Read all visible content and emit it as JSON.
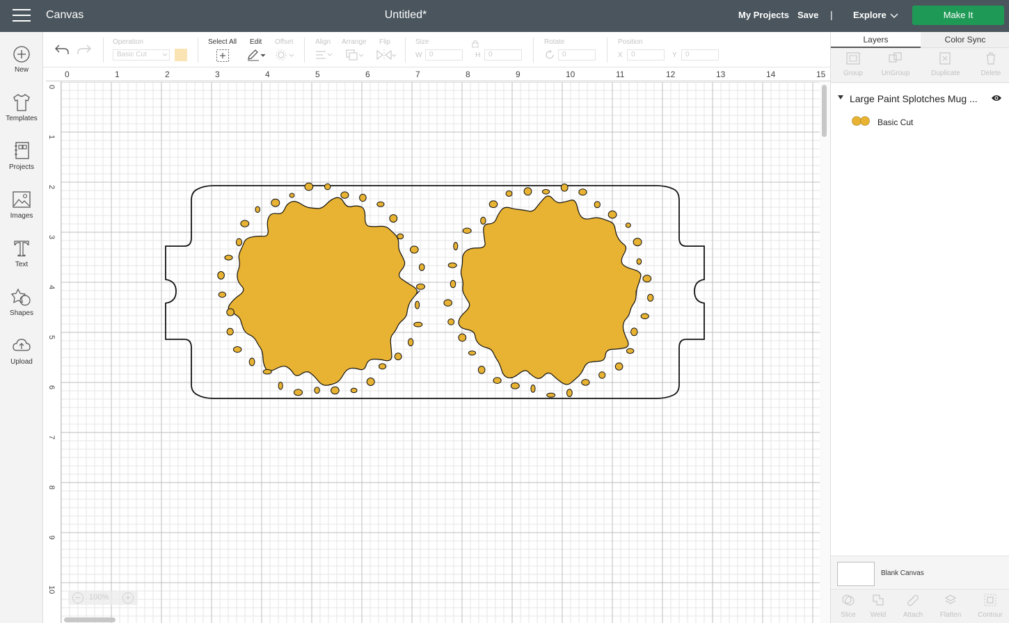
{
  "topbar": {
    "app_title": "Canvas",
    "doc_title": "Untitled*",
    "my_projects": "My Projects",
    "save": "Save",
    "divider": "|",
    "explore": "Explore",
    "make_it": "Make It"
  },
  "sidebar": {
    "items": [
      {
        "label": "New",
        "icon": "plus-circle-icon"
      },
      {
        "label": "Templates",
        "icon": "tshirt-icon"
      },
      {
        "label": "Projects",
        "icon": "projects-icon"
      },
      {
        "label": "Images",
        "icon": "image-icon"
      },
      {
        "label": "Text",
        "icon": "text-icon"
      },
      {
        "label": "Shapes",
        "icon": "shapes-icon"
      },
      {
        "label": "Upload",
        "icon": "upload-icon"
      }
    ]
  },
  "toolbar": {
    "operation_label": "Operation",
    "operation_value": "Basic Cut",
    "operation_color": "#fbe4b4",
    "select_all": "Select All",
    "edit": "Edit",
    "offset": "Offset",
    "align": "Align",
    "arrange": "Arrange",
    "flip": "Flip",
    "size": "Size",
    "size_w_label": "W",
    "size_w": "0",
    "size_h_label": "H",
    "size_h": "0",
    "rotate": "Rotate",
    "rotate_value": "0",
    "position": "Position",
    "pos_x_label": "X",
    "pos_x": "0",
    "pos_y_label": "Y",
    "pos_y": "0"
  },
  "rpanel": {
    "tabs": [
      "Layers",
      "Color Sync"
    ],
    "actions": [
      "Group",
      "UnGroup",
      "Duplicate",
      "Delete"
    ],
    "group_name": "Large Paint Splotches Mug ...",
    "layer_name": "Basic Cut",
    "layer_color": "#e8b333",
    "blank_canvas": "Blank Canvas",
    "bottom_actions": [
      "Slice",
      "Weld",
      "Attach",
      "Flatten",
      "Contour"
    ]
  },
  "canvas": {
    "ruler_top": [
      "0",
      "1",
      "2",
      "3",
      "4",
      "5",
      "6",
      "7",
      "8",
      "9",
      "10",
      "11",
      "12",
      "13",
      "14",
      "15"
    ],
    "ruler_left": [
      "0",
      "1",
      "2",
      "3",
      "4",
      "5",
      "6",
      "7",
      "8",
      "9",
      "10"
    ],
    "zoom_level": "100%",
    "splotch_color": "#e8b333"
  }
}
